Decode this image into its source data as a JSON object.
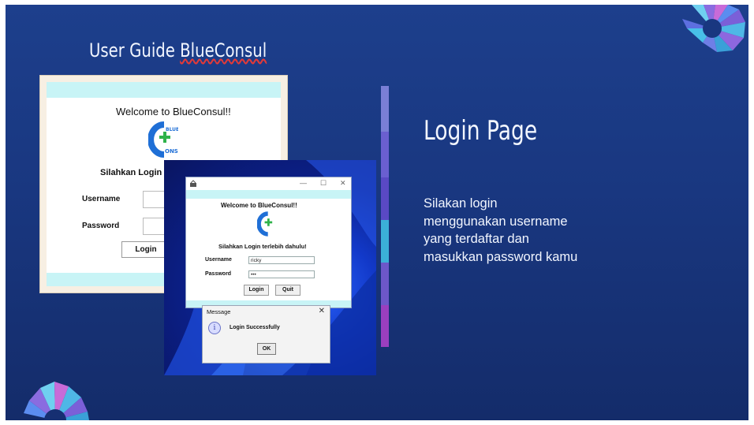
{
  "slide": {
    "title_prefix": "User Guide ",
    "title_app": "BlueConsul",
    "heading": "Login Page",
    "description": "Silakan login menggunakan username yang terdaftar dan masukkan password kamu"
  },
  "screenshot_back": {
    "welcome": "Welcome to BlueConsul!!",
    "instruction": "Silahkan Login te",
    "username_label": "Username",
    "password_label": "Password",
    "login_button": "Login"
  },
  "login_window": {
    "welcome": "Welcome to BlueConsul!!",
    "instruction": "Silahkan Login terlebih dahulu!",
    "username_label": "Username",
    "username_value": "ricky",
    "password_label": "Password",
    "password_value": "•••",
    "login_button": "Login",
    "quit_button": "Quit"
  },
  "message_dialog": {
    "title": "Message",
    "text": "Login Successfully",
    "ok_button": "OK",
    "close_glyph": "✕"
  },
  "window_controls": {
    "minimize": "—",
    "maximize": "☐",
    "close": "✕"
  },
  "colors": {
    "slide_bg": "#193780",
    "accent_cyan": "#c8f4f6",
    "accent_bar": [
      "#7a7fd6",
      "#6a5fd0",
      "#3bb0d8",
      "#6d57c9",
      "#9a3fbf"
    ]
  }
}
